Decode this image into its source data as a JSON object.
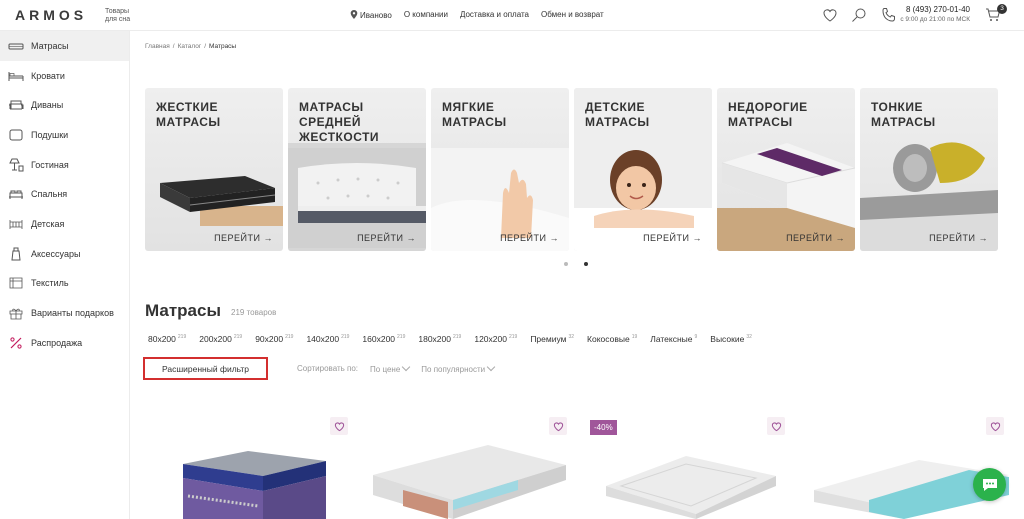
{
  "header": {
    "logo": "ARMOS",
    "logo_sub": "Товары для сна",
    "city": "Иваново",
    "nav": [
      "О компании",
      "Доставка и оплата",
      "Обмен и возврат"
    ],
    "phone": "8 (493) 270-01-40",
    "hours": "с 9:00 до 21:00 по МСК",
    "cart_count": "3"
  },
  "sidebar": {
    "items": [
      {
        "label": "Матрасы",
        "icon": "mattress-icon"
      },
      {
        "label": "Кровати",
        "icon": "bed-icon"
      },
      {
        "label": "Диваны",
        "icon": "sofa-icon"
      },
      {
        "label": "Подушки",
        "icon": "pillow-icon"
      },
      {
        "label": "Гостиная",
        "icon": "lamp-icon"
      },
      {
        "label": "Спальня",
        "icon": "bedroom-icon"
      },
      {
        "label": "Детская",
        "icon": "kids-icon"
      },
      {
        "label": "Аксессуары",
        "icon": "accessory-icon"
      },
      {
        "label": "Текстиль",
        "icon": "textile-icon"
      },
      {
        "label": "Варианты подарков",
        "icon": "gift-icon"
      },
      {
        "label": "Распродажа",
        "icon": "percent-icon"
      }
    ]
  },
  "breadcrumb": {
    "home": "Главная",
    "catalog": "Каталог",
    "current": "Матрасы"
  },
  "cards": [
    {
      "title": "ЖЕСТКИЕ\nМАТРАСЫ",
      "go": "ПЕРЕЙТИ →"
    },
    {
      "title": "МАТРАСЫ\nСРЕДНЕЙ\nЖЕСТКОСТИ",
      "go": "ПЕРЕЙТИ →"
    },
    {
      "title": "МЯГКИЕ\nМАТРАСЫ",
      "go": "ПЕРЕЙТИ →"
    },
    {
      "title": "ДЕТСКИЕ\nМАТРАСЫ",
      "go": "ПЕРЕЙТИ →"
    },
    {
      "title": "НЕДОРОГИЕ\nМАТРАСЫ",
      "go": "ПЕРЕЙТИ →"
    },
    {
      "title": "ТОНКИЕ\nМАТРАСЫ",
      "go": "ПЕРЕЙТИ →"
    }
  ],
  "section": {
    "title": "Матрасы",
    "count": "219 товаров"
  },
  "chips": [
    {
      "label": "80x200",
      "count": "219"
    },
    {
      "label": "200x200",
      "count": "219"
    },
    {
      "label": "90x200",
      "count": "219"
    },
    {
      "label": "140x200",
      "count": "219"
    },
    {
      "label": "160x200",
      "count": "219"
    },
    {
      "label": "180x200",
      "count": "219"
    },
    {
      "label": "120x200",
      "count": "219"
    },
    {
      "label": "Премиум",
      "count": "32"
    },
    {
      "label": "Кокосовые",
      "count": "19"
    },
    {
      "label": "Латексные",
      "count": "9"
    },
    {
      "label": "Высокие",
      "count": "32"
    }
  ],
  "filter": {
    "label": "Расширенный фильтр"
  },
  "sort": {
    "label": "Сортировать по:",
    "by_price": "По цене",
    "by_popularity": "По популярности"
  },
  "products": {
    "discount": "-40%"
  },
  "colors": {
    "accent": "#a0569a",
    "filter_border": "#d32f2f",
    "chat": "#2bb24c"
  }
}
